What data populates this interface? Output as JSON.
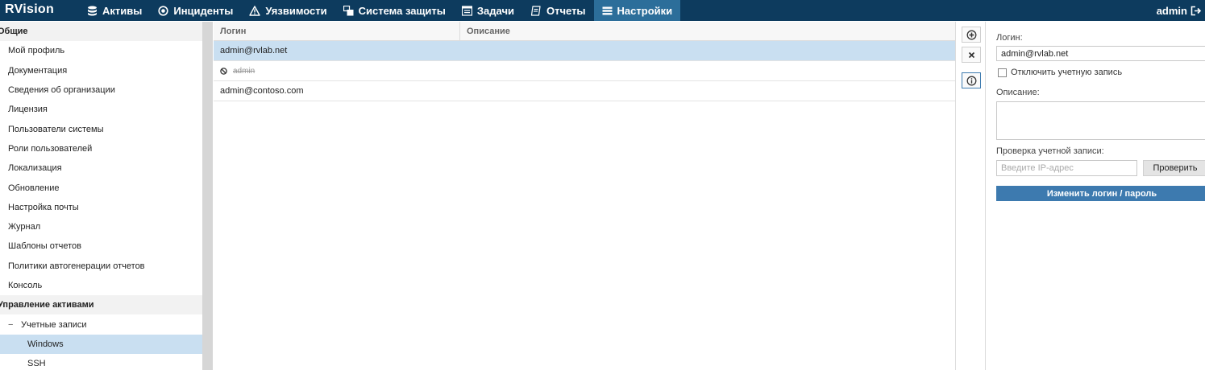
{
  "app": {
    "logo": "RVision",
    "user": "admin"
  },
  "nav": [
    {
      "label": "Активы",
      "icon": "database-icon"
    },
    {
      "label": "Инциденты",
      "icon": "target-icon"
    },
    {
      "label": "Уязвимости",
      "icon": "warning-icon"
    },
    {
      "label": "Система защиты",
      "icon": "windows-icon"
    },
    {
      "label": "Задачи",
      "icon": "tasks-icon"
    },
    {
      "label": "Отчеты",
      "icon": "reports-icon"
    },
    {
      "label": "Настройки",
      "icon": "settings-list-icon",
      "active": true
    }
  ],
  "sidebar": {
    "group1": "Общие",
    "items1": [
      "Мой профиль",
      "Документация",
      "Сведения об организации",
      "Лицензия",
      "Пользователи системы",
      "Роли пользователей",
      "Локализация",
      "Обновление",
      "Настройка почты",
      "Журнал",
      "Шаблоны отчетов",
      "Политики автогенерации отчетов",
      "Консоль"
    ],
    "group2": "Управление активами",
    "sub": "Учетные записи",
    "leaves": [
      "Windows",
      "SSH"
    ]
  },
  "grid": {
    "columns": [
      "Логин",
      "Описание"
    ],
    "rows": [
      {
        "login": "admin@rvlab.net",
        "description": "",
        "selected": true,
        "disabled": false
      },
      {
        "login": "admin",
        "description": "",
        "selected": false,
        "disabled": true
      },
      {
        "login": "admin@contoso.com",
        "description": "",
        "selected": false,
        "disabled": false
      }
    ]
  },
  "toolbar": {
    "icons": [
      "add-circle-icon",
      "close-icon",
      "info-icon"
    ]
  },
  "form": {
    "login_label": "Логин:",
    "login_value": "admin@rvlab.net",
    "disable_label": "Отключить учетную запись",
    "description_label": "Описание:",
    "description_value": "",
    "check_label": "Проверка учетной записи:",
    "ip_placeholder": "Введите IP-адрес",
    "check_button": "Проверить",
    "change_button": "Изменить логин / пароль"
  },
  "colors": {
    "topbar": "#0d3b5e",
    "nav_active": "#2c6e9a",
    "selection": "#c9dff1",
    "primary_button": "#3d7aaf"
  }
}
